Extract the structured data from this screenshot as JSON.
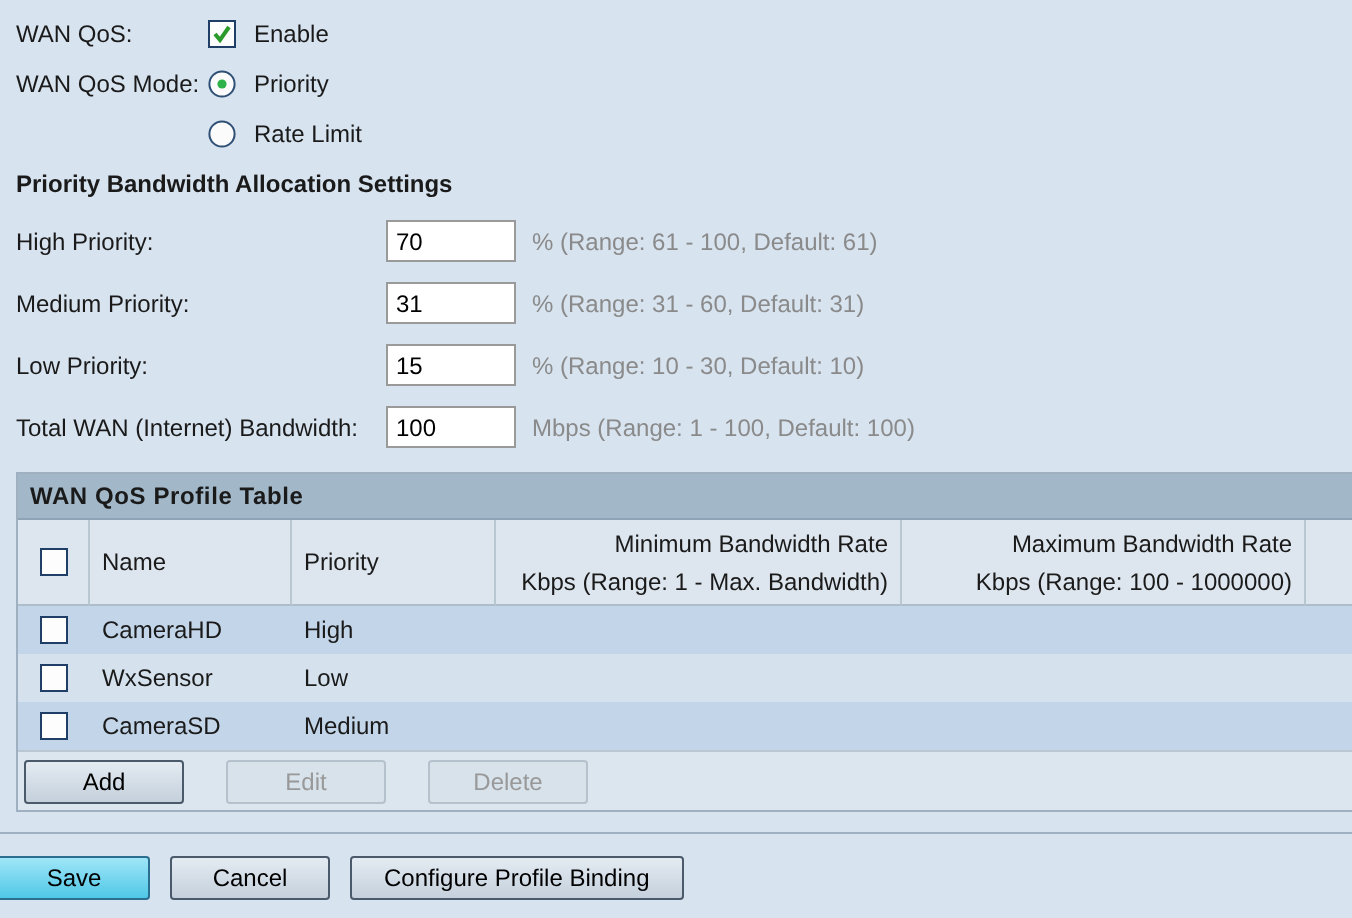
{
  "wan_qos": {
    "label": "WAN QoS:",
    "option": "Enable",
    "checked": true
  },
  "mode": {
    "label": "WAN QoS Mode:",
    "options": [
      {
        "label": "Priority",
        "selected": true
      },
      {
        "label": "Rate Limit",
        "selected": false
      }
    ]
  },
  "section_title": "Priority Bandwidth Allocation Settings",
  "fields": [
    {
      "label": "High Priority:",
      "value": "70",
      "hint": "% (Range: 61 - 100, Default: 61)"
    },
    {
      "label": "Medium Priority:",
      "value": "31",
      "hint": "% (Range: 31 - 60, Default: 31)"
    },
    {
      "label": "Low Priority:",
      "value": "15",
      "hint": "% (Range: 10 - 30, Default: 10)"
    },
    {
      "label": "Total WAN (Internet) Bandwidth:",
      "value": "100",
      "hint": "Mbps (Range: 1 - 100, Default: 100)"
    }
  ],
  "table": {
    "title": "WAN QoS Profile Table",
    "select_all": false,
    "columns": [
      [
        "Name"
      ],
      [
        "Priority"
      ],
      [
        "Minimum Bandwidth Rate",
        "Kbps (Range: 1 - Max. Bandwidth)"
      ],
      [
        "Maximum Bandwidth Rate",
        "Kbps (Range: 100 - 1000000)"
      ]
    ],
    "rows": [
      {
        "name": "CameraHD",
        "priority": "High",
        "checked": false
      },
      {
        "name": "WxSensor",
        "priority": "Low",
        "checked": false
      },
      {
        "name": "CameraSD",
        "priority": "Medium",
        "checked": false
      }
    ],
    "buttons": [
      {
        "label": "Add",
        "disabled": false
      },
      {
        "label": "Edit",
        "disabled": true
      },
      {
        "label": "Delete",
        "disabled": true
      }
    ]
  },
  "footer_buttons": [
    {
      "label": "Save",
      "kind": "primary"
    },
    {
      "label": "Cancel",
      "kind": "normal"
    },
    {
      "label": "Configure Profile Binding",
      "kind": "normal"
    }
  ]
}
